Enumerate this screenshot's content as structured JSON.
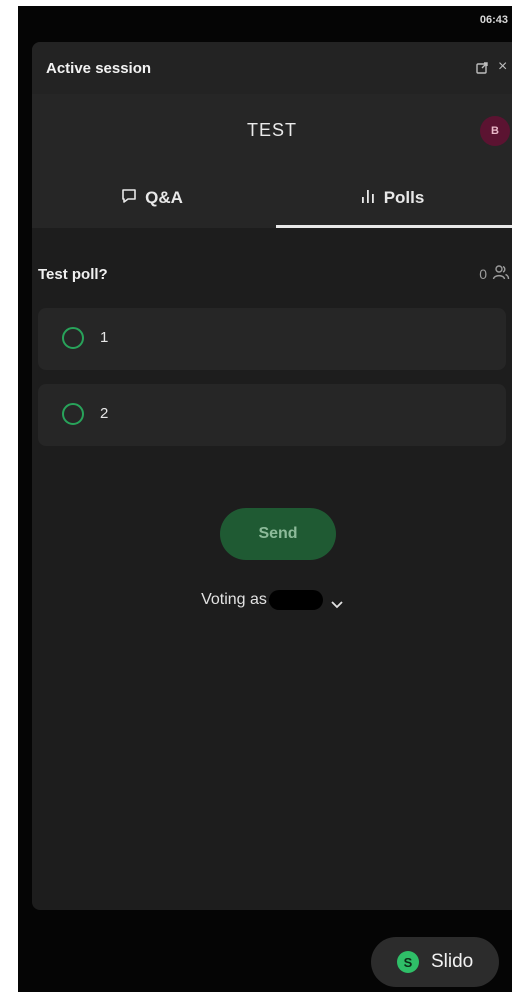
{
  "status_bar": {
    "time": "06:43"
  },
  "panel": {
    "title": "Active session",
    "icons": [
      "popout-icon",
      "close-icon"
    ],
    "close_glyph": "×"
  },
  "session": {
    "name": "TEST",
    "avatar_initial": "B",
    "avatar_color": "#5b1331"
  },
  "tabs": [
    {
      "label": "Q&A",
      "icon": "chat-bubble-icon",
      "active": false
    },
    {
      "label": "Polls",
      "icon": "bar-chart-icon",
      "active": true
    }
  ],
  "poll": {
    "question": "Test poll?",
    "participant_count": "0",
    "options": [
      {
        "label": "1",
        "selected": false
      },
      {
        "label": "2",
        "selected": false
      }
    ],
    "send_label": "Send",
    "voting_as_label": "Voting as"
  },
  "slido": {
    "logo_letter": "S",
    "label": "Slido",
    "accent": "#2fbf68"
  },
  "colors": {
    "radio_accent": "#28a35a",
    "send_button": "#1f5a33",
    "panel_bg": "#1d1d1d"
  }
}
